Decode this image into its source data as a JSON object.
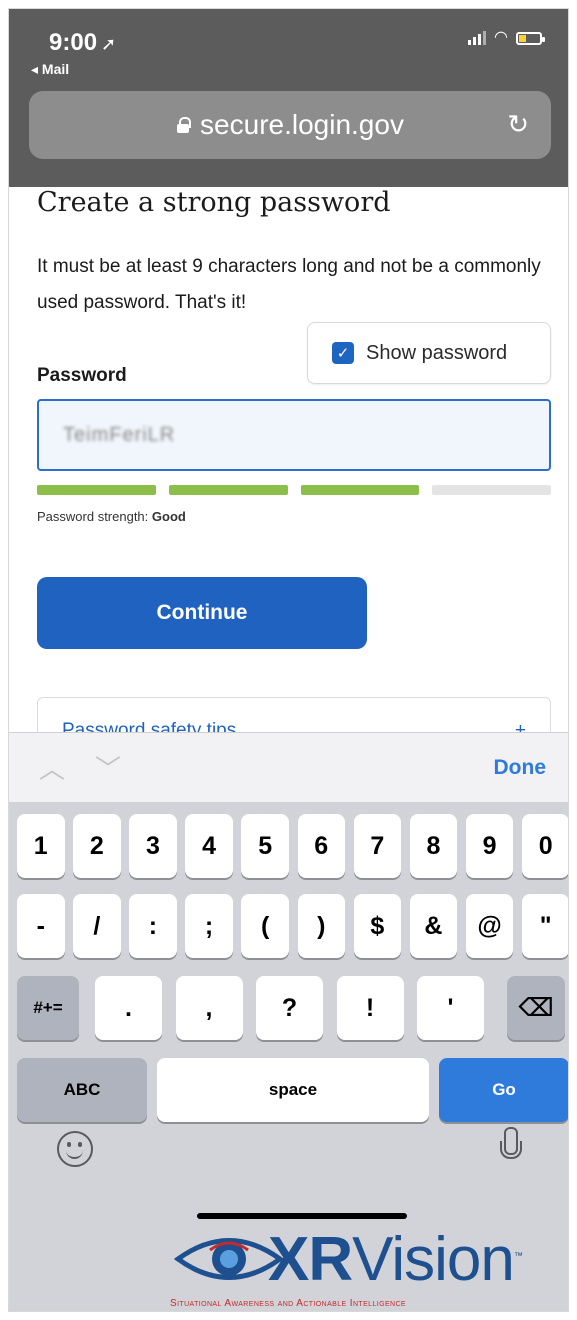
{
  "status_bar": {
    "time": "9:00",
    "back_label": "◂ Mail"
  },
  "address_bar": {
    "url": "secure.login.gov"
  },
  "page": {
    "title": "Create a strong password",
    "description": "It must be at least 9 characters long and not be a commonly used password. That's it!",
    "show_password_label": "Show password",
    "show_password_checked": true,
    "password_label": "Password",
    "password_value": "TeimFeriLR",
    "strength_prefix": "Password strength:",
    "strength_value": "Good",
    "strength_segments_filled": 3,
    "strength_segments_total": 4,
    "continue_label": "Continue",
    "accordion_label": "Password safety tips",
    "accordion_icon": "+"
  },
  "keyboard": {
    "done_label": "Done",
    "row1": [
      "1",
      "2",
      "3",
      "4",
      "5",
      "6",
      "7",
      "8",
      "9",
      "0"
    ],
    "row2": [
      "-",
      "/",
      ":",
      ";",
      "(",
      ")",
      "$",
      "&",
      "@",
      "\""
    ],
    "row3_left": "#+=",
    "row3": [
      ".",
      ",",
      "?",
      "!",
      "'"
    ],
    "abc_label": "ABC",
    "space_label": "space",
    "go_label": "Go"
  },
  "watermark": {
    "brand_xr": "XR",
    "brand_vision": "Vision",
    "tagline": "Situational Awareness and Actionable Intelligence",
    "trademark": "™"
  },
  "colors": {
    "strength_filled": "#8cbf4a",
    "strength_empty": "#e4e4e4",
    "primary": "#1f62c0",
    "go_key": "#2f7bdb"
  }
}
